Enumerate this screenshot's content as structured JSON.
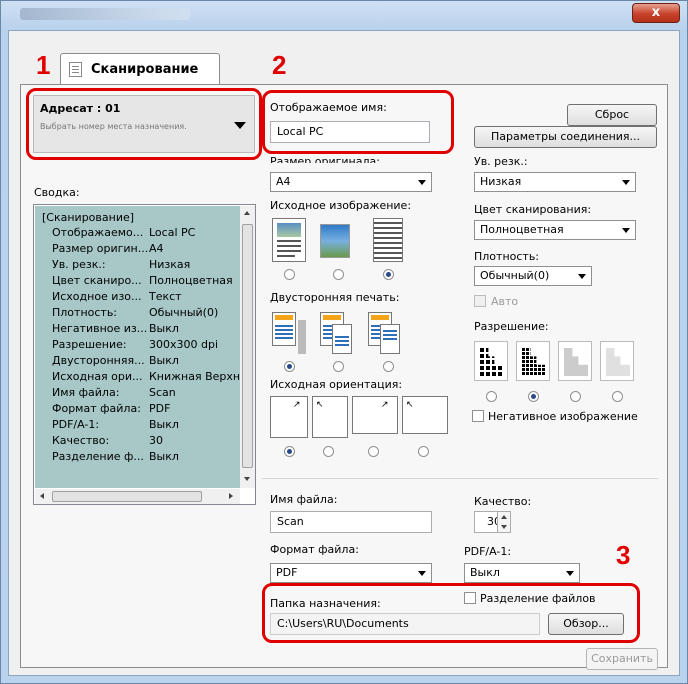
{
  "window": {
    "close_glyph": "x"
  },
  "tab": {
    "label": "Сканирование",
    "number": "1"
  },
  "numbers": {
    "two": "2",
    "three": "3"
  },
  "destination": {
    "title": "Адресат : 01",
    "hint": "Выбрать номер места назначения."
  },
  "display_name": {
    "label": "Отображаемое имя:",
    "value": "Local PC"
  },
  "buttons": {
    "reset": "Сброс",
    "connection": "Параметры соединения...",
    "browse": "Обзор...",
    "save": "Сохранить"
  },
  "original_size": {
    "label": "Размер оригинала:",
    "value": "A4"
  },
  "sharpness": {
    "label": "Ув. резк.:",
    "value": "Низкая"
  },
  "summary": {
    "label": "Сводка:",
    "header": "[Сканирование]",
    "rows": [
      {
        "k": "Отображаемо...",
        "v": "Local PC"
      },
      {
        "k": "Размер оригин...",
        "v": "A4"
      },
      {
        "k": "Ув. резк.:",
        "v": "Низкая"
      },
      {
        "k": "Цвет сканиро...",
        "v": "Полноцветная"
      },
      {
        "k": "Исходное изо...",
        "v": "Текст"
      },
      {
        "k": "Плотность:",
        "v": "Обычный(0)"
      },
      {
        "k": "Негативное из...",
        "v": "Выкл"
      },
      {
        "k": "Разрешение:",
        "v": "300x300 dpi"
      },
      {
        "k": "Двусторонняя...",
        "v": "Выкл"
      },
      {
        "k": "Исходная ори...",
        "v": "Книжная Верхни"
      },
      {
        "k": "Имя файла:",
        "v": "Scan"
      },
      {
        "k": "Формат файла:",
        "v": "PDF"
      },
      {
        "k": "PDF/A-1:",
        "v": "Выкл"
      },
      {
        "k": "Качество:",
        "v": "30"
      },
      {
        "k": "Разделение ф...",
        "v": "Выкл"
      }
    ]
  },
  "original_image": {
    "label": "Исходное изображение:",
    "options": [
      "text-photo",
      "photo",
      "text"
    ],
    "selected": 2
  },
  "scan_color": {
    "label": "Цвет сканирования:",
    "value": "Полноцветная"
  },
  "density": {
    "label": "Плотность:",
    "value": "Обычный(0)",
    "auto_label": "Авто"
  },
  "duplex": {
    "label": "Двусторонняя печать:",
    "selected": 0
  },
  "resolution": {
    "label": "Разрешение:",
    "selected": 1
  },
  "orientation": {
    "label": "Исходная ориентация:",
    "selected": 0
  },
  "negative": {
    "label": "Негативное изображение"
  },
  "file_name": {
    "label": "Имя файла:",
    "value": "Scan"
  },
  "quality": {
    "label": "Качество:",
    "value": "30"
  },
  "file_format": {
    "label": "Формат файла:",
    "value": "PDF"
  },
  "pdfa": {
    "label": "PDF/A-1:",
    "value": "Выкл"
  },
  "dest_folder": {
    "label": "Папка назначения:",
    "value": "C:\\Users\\RU\\Documents"
  },
  "split_files": {
    "label": "Разделение файлов"
  },
  "colors": {
    "accent_red": "#e00000",
    "summary_bg": "#a8c8c8"
  }
}
